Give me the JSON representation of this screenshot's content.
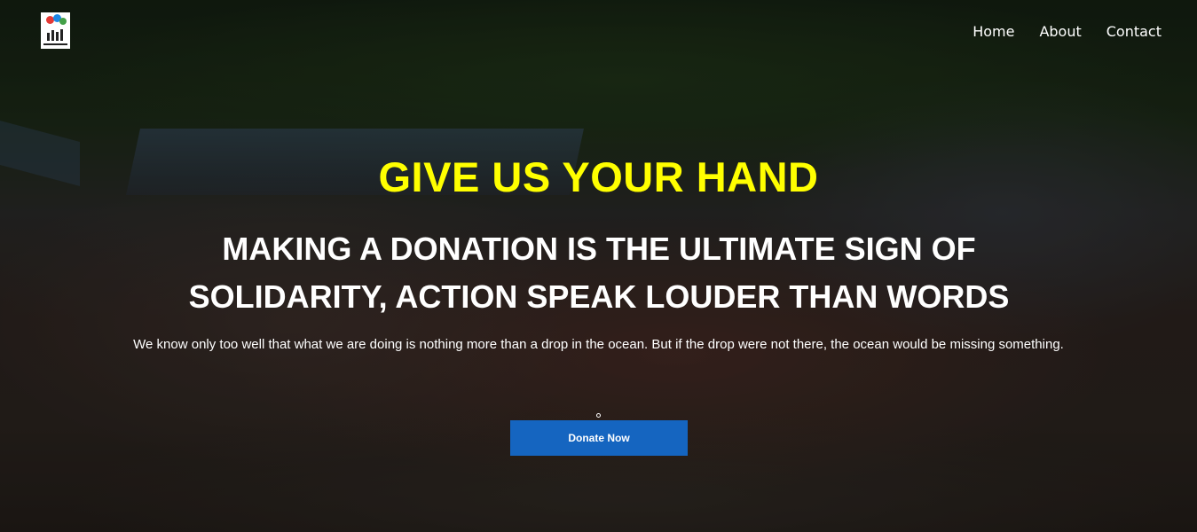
{
  "nav": {
    "items": [
      {
        "label": "Home"
      },
      {
        "label": "About"
      },
      {
        "label": "Contact"
      }
    ]
  },
  "hero": {
    "title": "GIVE US YOUR HAND",
    "subtitle": "MAKING A DONATION IS THE ULTIMATE SIGN OF SOLIDARITY, ACTION SPEAK LOUDER THAN WORDS",
    "description": "We know only too well that what we are doing is nothing more than a drop in the ocean. But if the drop were not there, the ocean would be missing something.",
    "button_label": "Donate Now"
  },
  "colors": {
    "title": "#ffff00",
    "button": "#1565c0"
  },
  "icons": {
    "logo": "charity-hands-logo-icon"
  }
}
